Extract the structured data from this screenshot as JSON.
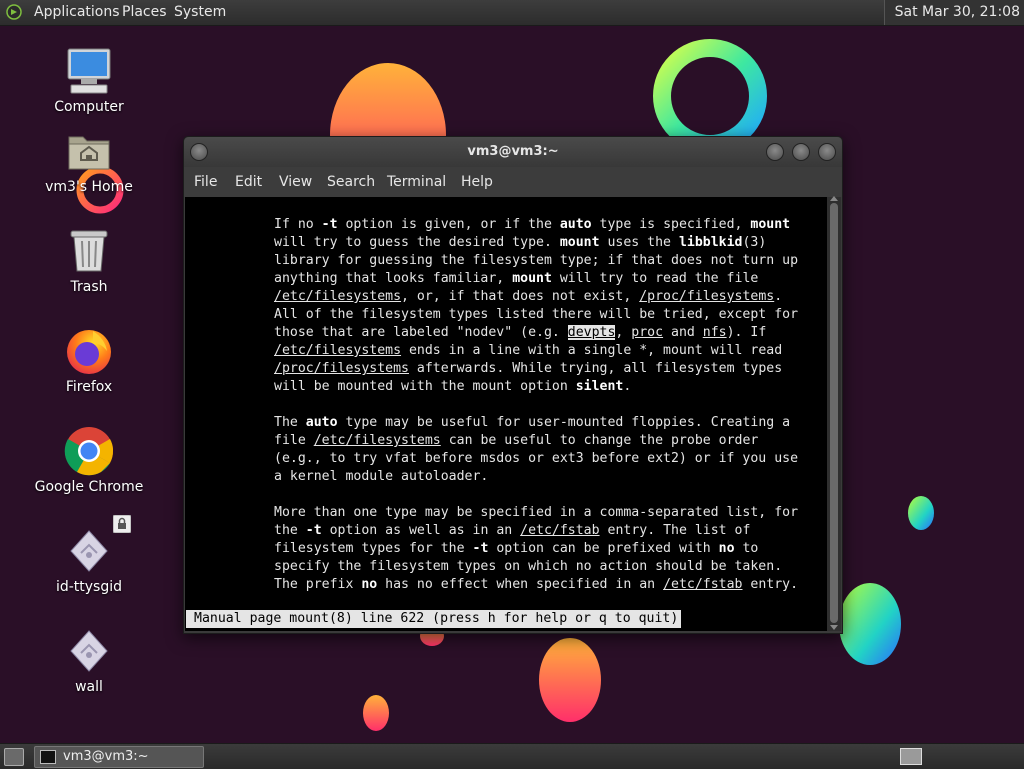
{
  "top_panel": {
    "menus": [
      "Applications",
      "Places",
      "System"
    ],
    "clock": "Sat Mar 30, 21:08"
  },
  "desktop_icons": [
    {
      "label": "Computer",
      "icon": "computer-icon"
    },
    {
      "label": "vm3's Home",
      "icon": "home-folder-icon"
    },
    {
      "label": "Trash",
      "icon": "trash-icon"
    },
    {
      "label": "Firefox",
      "icon": "firefox-icon"
    },
    {
      "label": "Google Chrome",
      "icon": "chrome-icon"
    },
    {
      "label": "id-ttysgid",
      "icon": "script-file-icon"
    },
    {
      "label": "wall",
      "icon": "script-file-icon"
    }
  ],
  "terminal": {
    "title": "vm3@vm3:~",
    "menu": [
      "File",
      "Edit",
      "View",
      "Search",
      "Terminal",
      "Help"
    ],
    "status_line": "Manual page mount(8) line 622 (press h for help or q to quit)"
  },
  "taskbar": {
    "window_label": "vm3@vm3:~"
  },
  "colors": {
    "panel_bg": "#2f2f2f",
    "terminal_bg": "#000000",
    "terminal_fg": "#e5e5e5",
    "wallpaper_bg": "#2a0f27"
  }
}
